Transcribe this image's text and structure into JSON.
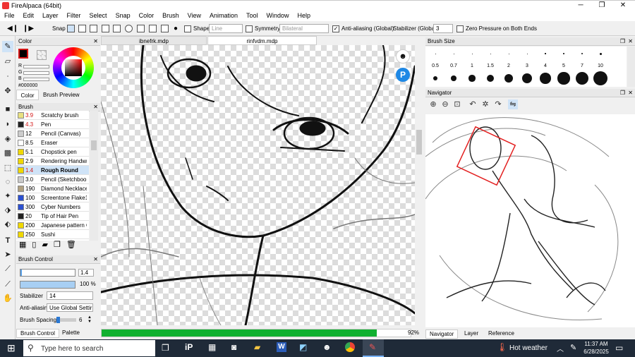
{
  "app": {
    "title": "FireAlpaca (64bit)"
  },
  "menu": [
    "File",
    "Edit",
    "Layer",
    "Filter",
    "Select",
    "Snap",
    "Color",
    "Brush",
    "View",
    "Animation",
    "Tool",
    "Window",
    "Help"
  ],
  "toolbar": {
    "snap": "Snap",
    "shape": "Shape",
    "shape_value": "Line",
    "symmetry": "Symmetry",
    "symmetry_value": "Bilateral",
    "antialias": "Anti-aliasing (Global)",
    "stabilizer": "Stabilizer (Global)",
    "stabilizer_value": "3",
    "zero_pressure": "Zero Pressure on Both Ends"
  },
  "tabs": [
    "ibnefrk.mdp",
    "rinfvdm.mdp"
  ],
  "color": {
    "header": "Color",
    "r": "R",
    "g": "G",
    "b": "B",
    "hex": "#000000",
    "tab_color": "Color",
    "tab_preview": "Brush Preview",
    "fg": "#d41616"
  },
  "brush": {
    "header": "Brush",
    "items": [
      {
        "size": "3.9",
        "name": "Scratchy brush",
        "color": "#e8e080",
        "red": true
      },
      {
        "size": "4.3",
        "name": "Pen",
        "color": "#222222",
        "red": true
      },
      {
        "size": "12",
        "name": "Pencil (Canvas)",
        "color": "#cccccc",
        "red": false
      },
      {
        "size": "8.5",
        "name": "Eraser",
        "color": "#ffffff",
        "red": false
      },
      {
        "size": "5.1",
        "name": "Chopstick pen",
        "color": "#f0d800",
        "red": false
      },
      {
        "size": "2.9",
        "name": "Rendering Handwriting",
        "color": "#f0d800",
        "red": false
      },
      {
        "size": "1.4",
        "name": "Rough Round",
        "color": "#f0d800",
        "red": true
      },
      {
        "size": "3.0",
        "name": "Pencil (Sketchbook)",
        "color": "#cccccc",
        "red": false
      },
      {
        "size": "190",
        "name": "Diamond Necklace",
        "color": "#b0a080",
        "red": false
      },
      {
        "size": "100",
        "name": "Screentone Flake1",
        "color": "#2c50d0",
        "red": false
      },
      {
        "size": "300",
        "name": "Cyber Numbers",
        "color": "#2c50d0",
        "red": false
      },
      {
        "size": "20",
        "name": "Tip of Hair Pen",
        "color": "#222222",
        "red": false
      },
      {
        "size": "200",
        "name": "Japanese pattern C",
        "color": "#f0d800",
        "red": false
      },
      {
        "size": "250",
        "name": "Sushi",
        "color": "#f0d800",
        "red": false
      }
    ]
  },
  "brush_control": {
    "header": "Brush Control",
    "size": "1.4",
    "opacity": "100 %",
    "stabilizer_label": "Stabilizer",
    "stabilizer_value": "14",
    "antialias_label": "Anti-aliasin",
    "antialias_value": "Use Global Settir",
    "spacing_label": "Brush Spacing",
    "spacing_value": "6",
    "tab1": "Brush Control",
    "tab2": "Palette"
  },
  "brush_size": {
    "header": "Brush Size",
    "row1": [
      "0.5",
      "0.7",
      "1",
      "1.5",
      "2",
      "3",
      "4",
      "5",
      "7",
      "10"
    ]
  },
  "navigator": {
    "header": "Navigator",
    "tabs": [
      "Navigator",
      "Layer",
      "Reference"
    ]
  },
  "status": {
    "zoom": "92%",
    "progress": 0.89
  },
  "taskbar": {
    "search": "Type here to search",
    "weather": "Hot weather",
    "time": "11:37 AM",
    "date": "6/28/2025"
  }
}
